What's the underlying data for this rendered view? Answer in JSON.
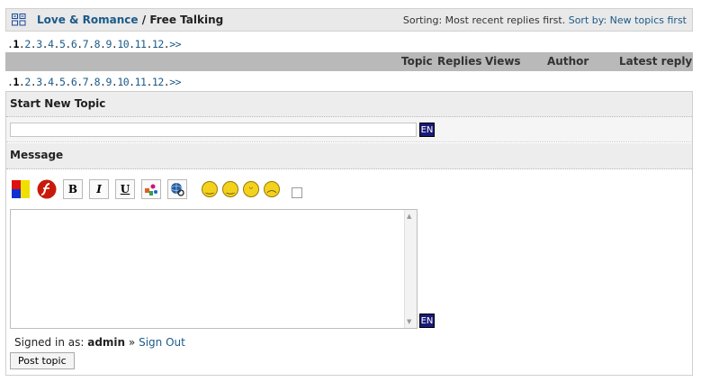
{
  "breadcrumb": {
    "forum": "Love & Romance",
    "separator": "/",
    "current": "Free Talking"
  },
  "sorting": {
    "label": "Sorting: Most recent replies first.",
    "link": "Sort by: New topics first"
  },
  "pagination": {
    "lead": ".",
    "current": "1",
    "pages": [
      "2",
      "3",
      "4",
      "5",
      "6",
      "7",
      "8",
      "9",
      "10",
      "11",
      "12"
    ],
    "separator": ".",
    "next": ">>"
  },
  "table_headers": [
    "Topic",
    "Replies",
    "Views",
    "Author",
    "Latest reply"
  ],
  "new_topic": {
    "section_title": "Start New Topic",
    "subject_value": "",
    "lang_badge": "EN",
    "message_title": "Message",
    "toolbar": [
      "color-icon",
      "flash-icon",
      "bold",
      "italic",
      "underline",
      "image-icon",
      "url-icon"
    ],
    "bold_label": "B",
    "italic_label": "I",
    "underline_label": "U",
    "smilies": [
      "smile-icon",
      "happy-icon",
      "tongue-icon",
      "sad-icon"
    ],
    "message_value": "",
    "signed_in_prefix": "Signed in as:",
    "username": "admin",
    "signout_sep": "»",
    "signout_label": "Sign Out",
    "submit_label": "Post topic"
  },
  "colors": {
    "link": "#1a5a8a",
    "header_bar": "#b9b9b9",
    "lang_badge": "#1a1a7a"
  }
}
